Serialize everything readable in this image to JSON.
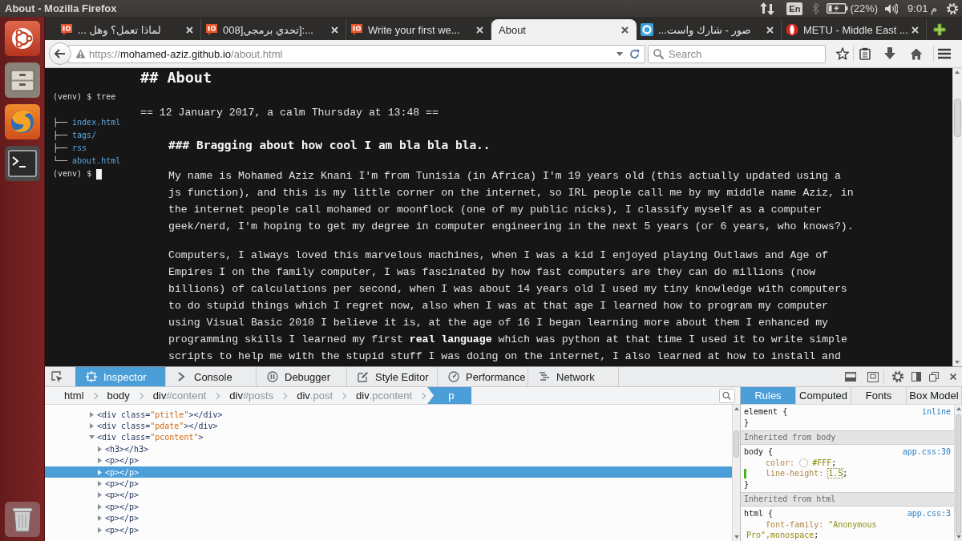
{
  "top_panel": {
    "window_title": "About - Mozilla Firefox",
    "keyboard_layout": "En",
    "battery_percent": "(22%)",
    "clock": "9:01 م"
  },
  "tabs": [
    {
      "label": "... لماذا تعمل؟ وهل",
      "selected": false,
      "kind": "bubble"
    },
    {
      "label": "008]تحدي برمجي]:...",
      "selected": false,
      "kind": "bubble"
    },
    {
      "label": "Write your first we...",
      "selected": false,
      "kind": "bubble"
    },
    {
      "label": "About",
      "selected": true,
      "kind": "plain"
    },
    {
      "label": "...صور - شارك واست",
      "selected": false,
      "kind": "ring"
    },
    {
      "label": "METU - Middle East ...",
      "selected": false,
      "kind": "disc"
    }
  ],
  "address_bar": {
    "scheme": "https://",
    "host": "mohamed-aziz.github.io",
    "path": "/about.html"
  },
  "search": {
    "placeholder": "Search"
  },
  "page": {
    "terminal": {
      "command_line": "(venv) $ tree",
      "entries": [
        {
          "branch": "├──",
          "name": "index.html"
        },
        {
          "branch": "├──",
          "name": "tags/"
        },
        {
          "branch": "├──",
          "name": "rss"
        },
        {
          "branch": "└──",
          "name": "about.html"
        }
      ],
      "prompt": "(venv) $"
    },
    "heading": "## About",
    "date_line": "== 12 January 2017, a calm Thursday at 13:48 ==",
    "post_title": "### Bragging about how cool I am bla bla bla..",
    "paragraphs": [
      "My name is Mohamed Aziz Knani I'm from Tunisia (in Africa) I'm 19 years old (this actually updated using a js function), and this is my little corner on the internet, so IRL people call me by my middle name Aziz, in the internet people call mohamed or moonflock (one of my public nicks), I classify myself as a computer geek/nerd, I'm hoping to get my degree in computer engineering in the next 5 years (or 6 years, who knows?).",
      "Computers, I always loved this marvelous machines, when I was a kid I enjoyed playing Outlaws and Age of Empires I on the family computer, I was fascinated by how fast computers are they can do millions (now billions) of calculations per second, when I was about 14 years old I used my tiny knowledge with computers to do stupid things which I regret now, also when I was at that age I learned how to program my computer using Visual Basic 2010 I believe it is, at the age of 16 I began learning more about them I enhanced my programming skills I learned my first **real language** which was python at that time I used it to write simple scripts to help me with the stupid stuff I was doing on the internet, I also learned at how to install and"
    ]
  },
  "devtools": {
    "tabs": [
      {
        "label": "Inspector",
        "selected": true,
        "kind": "inspector"
      },
      {
        "label": "Console",
        "selected": false,
        "kind": "console"
      },
      {
        "label": "Debugger",
        "selected": false,
        "kind": "debugger"
      },
      {
        "label": "Style Editor",
        "selected": false,
        "kind": "style_editor"
      },
      {
        "label": "Performance",
        "selected": false,
        "kind": "performance"
      },
      {
        "label": "Network",
        "selected": false,
        "kind": "network"
      }
    ],
    "breadcrumbs": [
      {
        "tag": "html",
        "selected": false
      },
      {
        "tag": "body",
        "selected": false
      },
      {
        "tag": "div",
        "qualifier": "#content",
        "selected": false
      },
      {
        "tag": "div",
        "qualifier": "#posts",
        "selected": false
      },
      {
        "tag": "div",
        "qualifier": ".post",
        "selected": false
      },
      {
        "tag": "div",
        "qualifier": ".pcontent",
        "selected": false
      },
      {
        "tag": "p",
        "selected": true
      }
    ],
    "markup": [
      {
        "parts": [
          {
            "kind": "tag",
            "text": "<div class="
          },
          {
            "kind": "value",
            "text": "\"ptitle\""
          },
          {
            "kind": "tag",
            "text": "></div>"
          }
        ],
        "expanded": false,
        "selected": false
      },
      {
        "parts": [
          {
            "kind": "tag",
            "text": "<div class="
          },
          {
            "kind": "value",
            "text": "\"pdate\""
          },
          {
            "kind": "tag",
            "text": "></div>"
          }
        ],
        "expanded": false,
        "selected": false
      },
      {
        "parts": [
          {
            "kind": "tag",
            "text": "<div class="
          },
          {
            "kind": "value",
            "text": "\"pcontent\""
          },
          {
            "kind": "tag",
            "text": ">"
          }
        ],
        "expanded": true,
        "selected": false,
        "children": [
          {
            "parts": [
              {
                "kind": "tag",
                "text": "<h3></h3>"
              }
            ],
            "expanded": false,
            "selected": false
          },
          {
            "parts": [
              {
                "kind": "tag",
                "text": "<p></p>"
              }
            ],
            "expanded": false,
            "selected": false
          },
          {
            "parts": [
              {
                "kind": "tag",
                "text": "<p></p>"
              }
            ],
            "expanded": false,
            "selected": true
          },
          {
            "parts": [
              {
                "kind": "tag",
                "text": "<p></p>"
              }
            ],
            "expanded": false,
            "selected": false
          },
          {
            "parts": [
              {
                "kind": "tag",
                "text": "<p></p>"
              }
            ],
            "expanded": false,
            "selected": false
          },
          {
            "parts": [
              {
                "kind": "tag",
                "text": "<p></p>"
              }
            ],
            "expanded": false,
            "selected": false
          },
          {
            "parts": [
              {
                "kind": "tag",
                "text": "<p></p>"
              }
            ],
            "expanded": false,
            "selected": false
          },
          {
            "parts": [
              {
                "kind": "tag",
                "text": "<p></p>"
              }
            ],
            "expanded": false,
            "selected": false
          }
        ]
      }
    ],
    "sidebar_tabs": [
      {
        "label": "Rules",
        "selected": true
      },
      {
        "label": "Computed",
        "selected": false
      },
      {
        "label": "Fonts",
        "selected": false
      },
      {
        "label": "Box Model",
        "selected": false
      }
    ],
    "rules": [
      {
        "kind": "rule",
        "selector": "element {",
        "source": "inline",
        "close": "}"
      },
      {
        "kind": "header",
        "text": "Inherited from body"
      },
      {
        "kind": "rule",
        "selector": "body {",
        "source": "app.css:30",
        "close": "}",
        "declarations": [
          {
            "name": "color:",
            "value": "#FFF",
            "end": ";",
            "color": "#ffffff",
            "modified": false,
            "editing": false
          },
          {
            "name": "line-height:",
            "value": "1.5",
            "end": ";",
            "modified": true,
            "editing": true
          }
        ]
      },
      {
        "kind": "header",
        "text": "Inherited from html"
      },
      {
        "kind": "rule",
        "selector": "html {",
        "source": "app.css:3",
        "declarations": [
          {
            "name": "font-family:",
            "value": "\"Anonymous Pro\",monospace",
            "end": ";",
            "modified": false,
            "editing": false
          }
        ]
      }
    ]
  }
}
